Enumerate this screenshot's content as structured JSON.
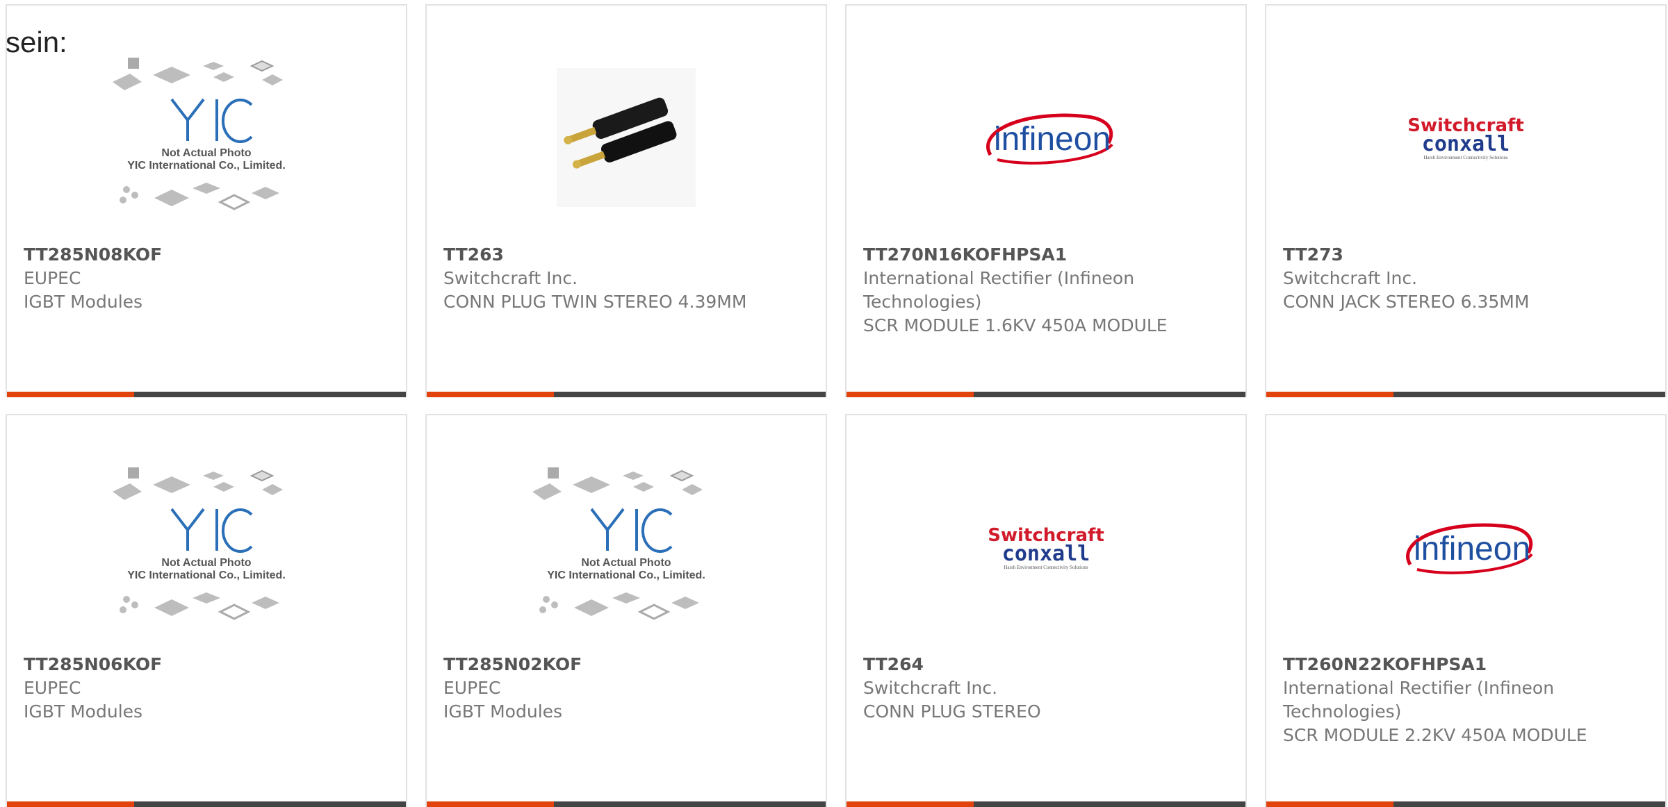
{
  "intro_text": "sein:",
  "colors": {
    "accent": "#e2420c",
    "bar_dark": "#444444",
    "card_border": "#e2e2e2",
    "infineon_blue": "#1f4fa0",
    "infineon_red": "#d7001c",
    "switchcraft_red": "#d11a2a",
    "conxall_blue": "#1f3b8c"
  },
  "yic_logo": {
    "caption_line1": "Not Actual Photo",
    "caption_line2": "YIC International Co., Limited.",
    "mark": "YIC"
  },
  "infineon_logo": {
    "text": "infineon"
  },
  "switchcraft_logo": {
    "line1": "Switchcraft",
    "line2": "conxall",
    "tagline": "Harsh Environment Connectivity Solutions"
  },
  "products": [
    {
      "part": "TT285N08KOF",
      "manufacturer": "EUPEC",
      "description": "IGBT Modules",
      "image": "yic-placeholder"
    },
    {
      "part": "TT263",
      "manufacturer": "Switchcraft Inc.",
      "description": "CONN PLUG TWIN STEREO 4.39MM",
      "image": "stereo-plug-photo"
    },
    {
      "part": "TT270N16KOFHPSA1",
      "manufacturer": "International Rectifier (Infineon Technologies)",
      "description": "SCR MODULE 1.6KV 450A MODULE",
      "image": "infineon-logo"
    },
    {
      "part": "TT273",
      "manufacturer": "Switchcraft Inc.",
      "description": "CONN JACK STEREO 6.35MM",
      "image": "switchcraft-logo"
    },
    {
      "part": "TT285N06KOF",
      "manufacturer": "EUPEC",
      "description": "IGBT Modules",
      "image": "yic-placeholder"
    },
    {
      "part": "TT285N02KOF",
      "manufacturer": "EUPEC",
      "description": "IGBT Modules",
      "image": "yic-placeholder"
    },
    {
      "part": "TT264",
      "manufacturer": "Switchcraft Inc.",
      "description": "CONN PLUG STEREO",
      "image": "switchcraft-logo"
    },
    {
      "part": "TT260N22KOFHPSA1",
      "manufacturer": "International Rectifier (Infineon Technologies)",
      "description": "SCR MODULE 2.2KV 450A MODULE",
      "image": "infineon-logo"
    }
  ]
}
